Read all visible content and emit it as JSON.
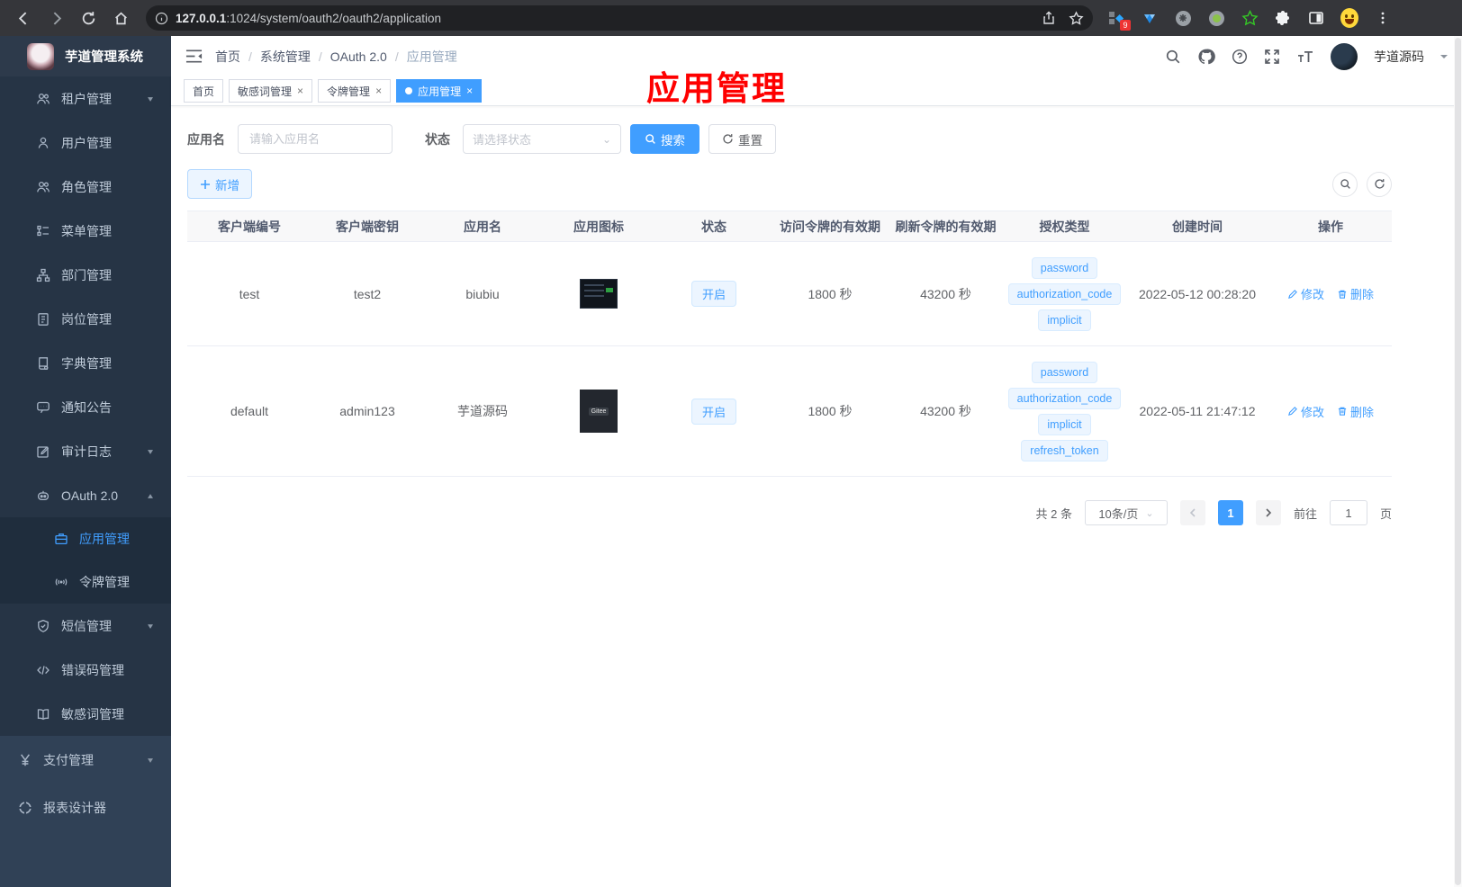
{
  "browser": {
    "url_host": "127.0.0.1",
    "url_rest": ":1024/system/oauth2/oauth2/application",
    "extension_badge": "9"
  },
  "annotation": {
    "text": "应用管理"
  },
  "sidebar": {
    "logo_title": "芋道管理系统",
    "items": [
      {
        "label": "租户管理",
        "icon": "users-icon"
      },
      {
        "label": "用户管理",
        "icon": "user-icon"
      },
      {
        "label": "角色管理",
        "icon": "role-icon"
      },
      {
        "label": "菜单管理",
        "icon": "tree-menu-icon"
      },
      {
        "label": "部门管理",
        "icon": "org-chart-icon"
      },
      {
        "label": "岗位管理",
        "icon": "id-badge-icon"
      },
      {
        "label": "字典管理",
        "icon": "dictionary-icon"
      },
      {
        "label": "通知公告",
        "icon": "notice-icon"
      },
      {
        "label": "审计日志",
        "icon": "audit-log-icon"
      },
      {
        "label": "OAuth 2.0",
        "icon": "robot-icon"
      },
      {
        "label": "应用管理",
        "icon": "briefcase-icon"
      },
      {
        "label": "令牌管理",
        "icon": "token-icon"
      },
      {
        "label": "短信管理",
        "icon": "shield-check-icon"
      },
      {
        "label": "错误码管理",
        "icon": "code-icon"
      },
      {
        "label": "敏感词管理",
        "icon": "open-book-icon"
      },
      {
        "label": "支付管理",
        "icon": "yen-icon"
      },
      {
        "label": "报表设计器",
        "icon": "report-designer-icon"
      }
    ]
  },
  "navbar": {
    "breadcrumbs": [
      "首页",
      "系统管理",
      "OAuth 2.0",
      "应用管理"
    ],
    "username": "芋道源码"
  },
  "tabs": [
    {
      "label": "首页"
    },
    {
      "label": "敏感词管理"
    },
    {
      "label": "令牌管理"
    },
    {
      "label": "应用管理"
    }
  ],
  "filters": {
    "name_label": "应用名",
    "name_placeholder": "请输入应用名",
    "status_label": "状态",
    "status_placeholder": "请选择状态",
    "search_label": "搜索",
    "reset_label": "重置",
    "add_label": "新增"
  },
  "table": {
    "columns": [
      "客户端编号",
      "客户端密钥",
      "应用名",
      "应用图标",
      "状态",
      "访问令牌的有效期",
      "刷新令牌的有效期",
      "授权类型",
      "创建时间",
      "操作"
    ],
    "rows": [
      {
        "client_id": "test",
        "secret": "test2",
        "name": "biubiu",
        "icon": "screenshot-thumbnail",
        "status": "开启",
        "access_ttl": "1800 秒",
        "refresh_ttl": "43200 秒",
        "grants": [
          "password",
          "authorization_code",
          "implicit"
        ],
        "created": "2022-05-12 00:28:20",
        "edit": "修改",
        "delete": "删除"
      },
      {
        "client_id": "default",
        "secret": "admin123",
        "name": "芋道源码",
        "icon": "gitee-logo",
        "icon_label": "Gitee",
        "status": "开启",
        "access_ttl": "1800 秒",
        "refresh_ttl": "43200 秒",
        "grants": [
          "password",
          "authorization_code",
          "implicit",
          "refresh_token"
        ],
        "created": "2022-05-11 21:47:12",
        "edit": "修改",
        "delete": "删除"
      }
    ]
  },
  "pagination": {
    "total": "共 2 条",
    "page_size": "10条/页",
    "current_page": "1",
    "goto_label": "前往",
    "goto_value": "1",
    "page_label": "页"
  },
  "colors": {
    "primary": "#409EFF",
    "sidebar_bg": "#304156",
    "submenu_bg": "#263445",
    "nested_bg": "#1f2d3d",
    "annotation_red": "#fe0000",
    "tag_bg": "#ecf5ff"
  }
}
